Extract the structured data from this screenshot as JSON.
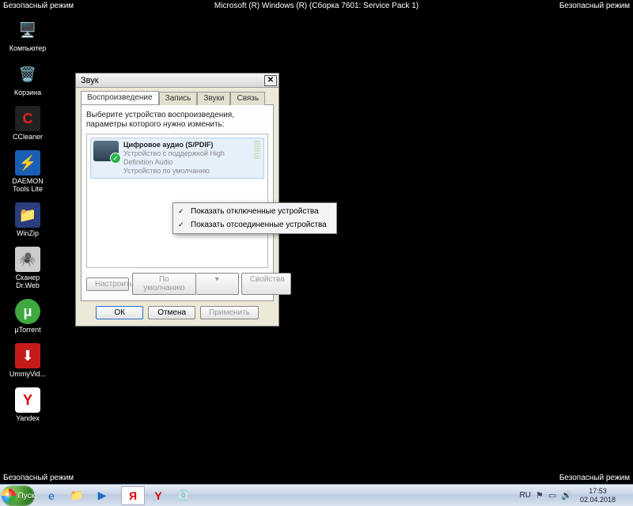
{
  "safe_mode": {
    "label": "Безопасный режим",
    "center": "Microsoft (R) Windows (R) (Сборка 7601: Service Pack 1)"
  },
  "desktop_icons": [
    {
      "name": "Компьютер",
      "icon": "🖥️",
      "bg": ""
    },
    {
      "name": "Корзина",
      "icon": "🗑️",
      "bg": ""
    },
    {
      "name": "CCleaner",
      "icon": "C",
      "bg": "#d22"
    },
    {
      "name": "DAEMON Tools Lite",
      "icon": "⚡",
      "bg": "#1a5fb4"
    },
    {
      "name": "WinZip",
      "icon": "📁",
      "bg": "#f5a623"
    },
    {
      "name": "Сканер Dr.Web",
      "icon": "🕷️",
      "bg": "#ddd"
    },
    {
      "name": "μTorrent",
      "icon": "μ",
      "bg": "#3fa83f"
    },
    {
      "name": "UmmyVid...",
      "icon": "⬇",
      "bg": "#c61b1b"
    },
    {
      "name": "Yandex",
      "icon": "Y",
      "bg": "#fff"
    }
  ],
  "dialog": {
    "title": "Звук",
    "tabs": [
      "Воспроизведение",
      "Запись",
      "Звуки",
      "Связь"
    ],
    "active_tab": 0,
    "instruction": "Выберите устройство воспроизведения, параметры которого нужно изменить:",
    "device": {
      "name": "Цифровое аудио (S/PDIF)",
      "sub1": "Устройство с поддержкой High Definition Audio",
      "sub2": "Устройство по умолчанию"
    },
    "btn_configure": "Настроить",
    "btn_default": "По умолчанию",
    "btn_properties": "Свойства",
    "btn_ok": "ОК",
    "btn_cancel": "Отмена",
    "btn_apply": "Применить"
  },
  "context_menu": {
    "item1": "Показать отключенные устройства",
    "item2": "Показать отсоединенные устройства"
  },
  "taskbar": {
    "start": "Пуск",
    "lang": "RU",
    "time": "17:53",
    "date": "02.04.2018"
  }
}
